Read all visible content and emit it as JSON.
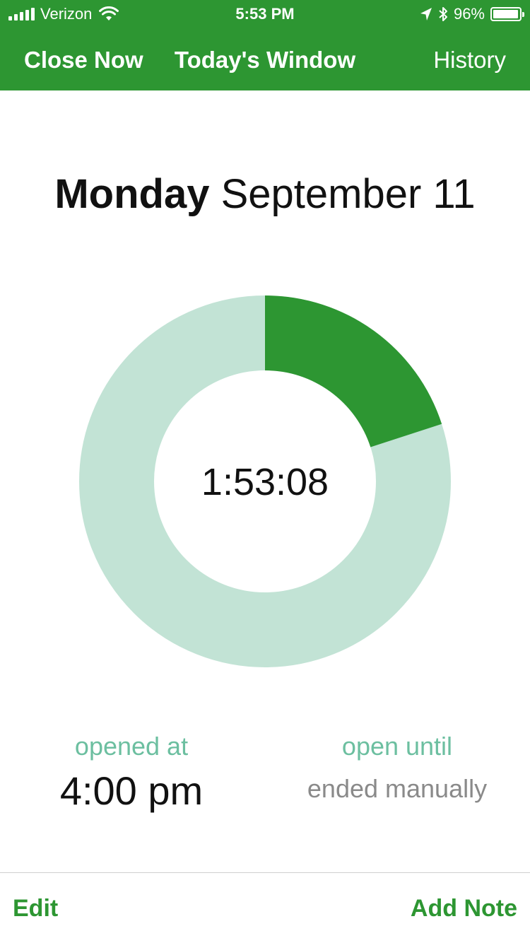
{
  "status_bar": {
    "carrier": "Verizon",
    "time": "5:53 PM",
    "battery_percent": "96%",
    "battery_level": 0.96
  },
  "nav": {
    "close_label": "Close Now",
    "title": "Today's Window",
    "history_label": "History"
  },
  "date": {
    "weekday": "Monday",
    "date": "September 11"
  },
  "progress": {
    "timer": "1:53:08",
    "elapsed_fraction": 0.2,
    "colors": {
      "elapsed": "#2d9632",
      "remaining": "#c2e3d5"
    }
  },
  "opened": {
    "label": "opened at",
    "value": "4:00 pm"
  },
  "open_until": {
    "label": "open until",
    "value": "ended manually"
  },
  "toolbar": {
    "edit_label": "Edit",
    "add_note_label": "Add Note"
  },
  "colors": {
    "brand": "#2d9632",
    "label": "#6cbfa0"
  }
}
